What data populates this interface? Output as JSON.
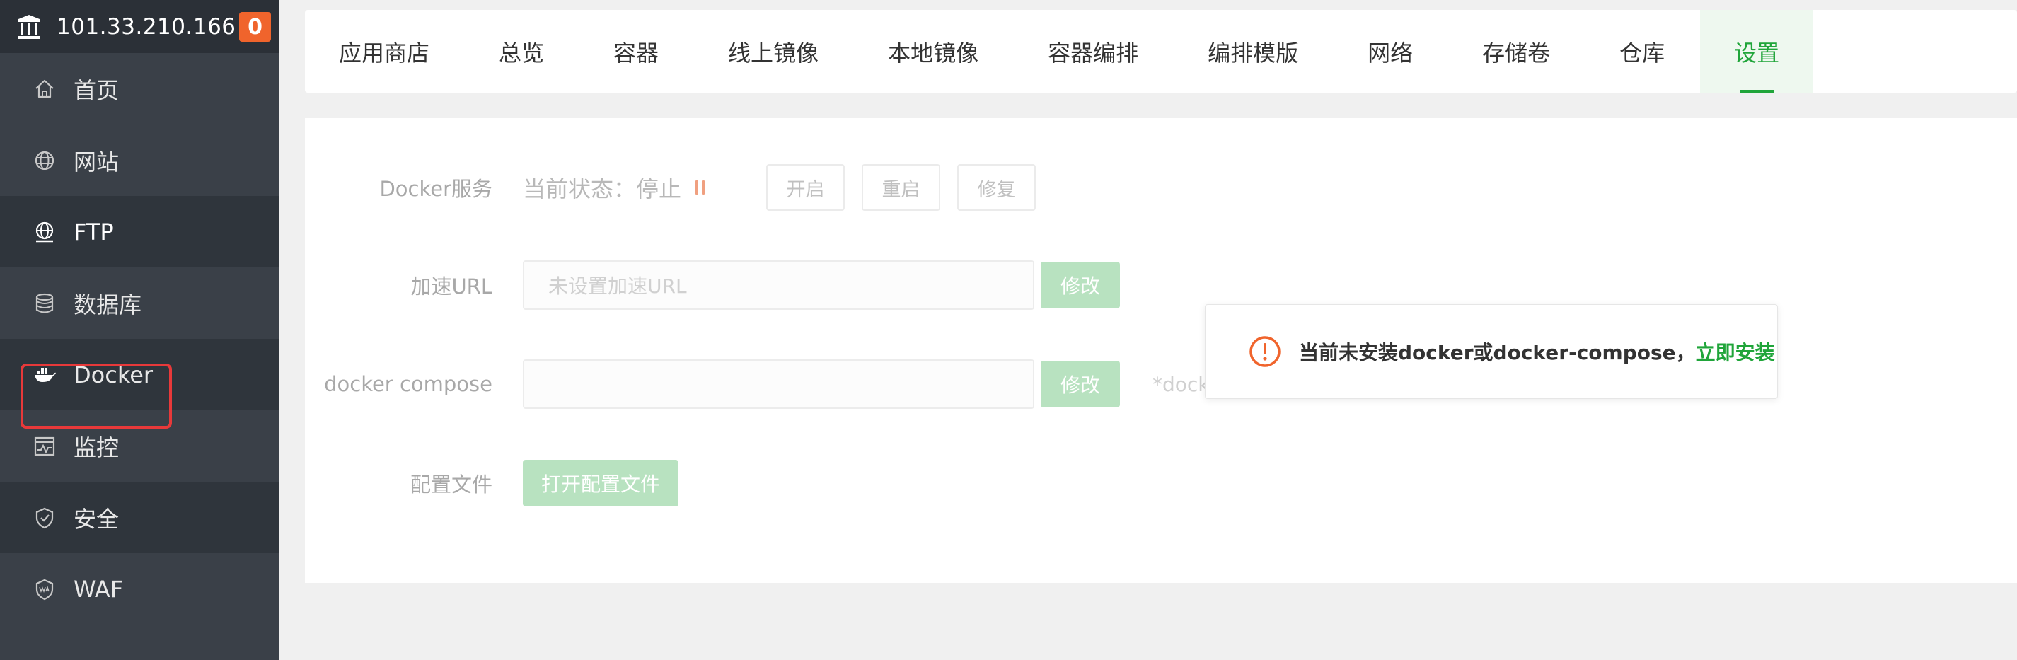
{
  "sidebar": {
    "server_ip": "101.33.210.166",
    "alert_count": "0",
    "items": [
      {
        "label": "首页",
        "icon": "home-icon"
      },
      {
        "label": "网站",
        "icon": "globe-icon"
      },
      {
        "label": "FTP",
        "icon": "ftp-icon"
      },
      {
        "label": "数据库",
        "icon": "database-icon"
      },
      {
        "label": "Docker",
        "icon": "docker-icon"
      },
      {
        "label": "监控",
        "icon": "monitor-icon"
      },
      {
        "label": "安全",
        "icon": "shield-icon"
      },
      {
        "label": "WAF",
        "icon": "waf-icon"
      }
    ]
  },
  "tabs": [
    {
      "label": "应用商店"
    },
    {
      "label": "总览"
    },
    {
      "label": "容器"
    },
    {
      "label": "线上镜像"
    },
    {
      "label": "本地镜像"
    },
    {
      "label": "容器编排"
    },
    {
      "label": "编排模版"
    },
    {
      "label": "网络"
    },
    {
      "label": "存储卷"
    },
    {
      "label": "仓库"
    },
    {
      "label": "设置"
    }
  ],
  "settings": {
    "docker_service": {
      "label": "Docker服务",
      "status": "当前状态：停止",
      "start_btn": "开启",
      "restart_btn": "重启",
      "repair_btn": "修复"
    },
    "mirror_url": {
      "label": "加速URL",
      "placeholder": "未设置加速URL",
      "modify_btn": "修改"
    },
    "docker_compose": {
      "label": "docker compose",
      "value": "",
      "modify_btn": "修改",
      "hint": "*dock"
    },
    "config_file": {
      "label": "配置文件",
      "open_btn": "打开配置文件"
    }
  },
  "notice": {
    "message": "当前未安装docker或docker-compose，",
    "link": "立即安装"
  },
  "colors": {
    "accent_green": "#20a53a",
    "sidebar_bg": "#3a4048",
    "badge_orange": "#f0642c",
    "warning_orange": "#f0642c"
  }
}
